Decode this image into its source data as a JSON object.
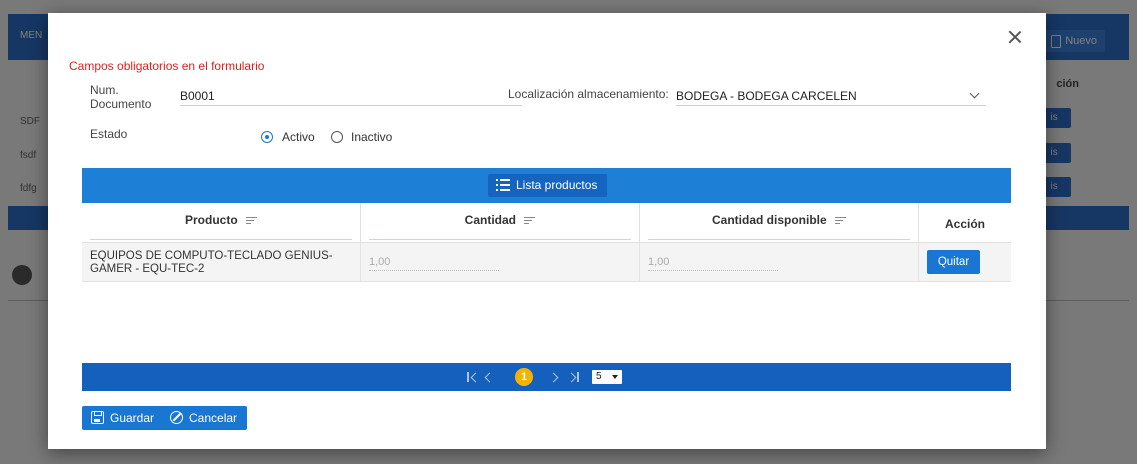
{
  "background": {
    "menu_label": "MEN",
    "nuevo_label": "Nuevo",
    "accion_header": "ción",
    "row_labels": [
      "SDF",
      "fsdf",
      "fdfg"
    ],
    "row_button": "is"
  },
  "modal": {
    "required_note": "Campos obligatorios en el formulario",
    "num_documento_label": "Num. Documento",
    "num_documento_value": "B0001",
    "localizacion_label": "Localización almacenamiento:",
    "localizacion_value": "BODEGA - BODEGA CARCELEN",
    "estado_label": "Estado",
    "estado_options": [
      {
        "label": "Activo",
        "checked": true
      },
      {
        "label": "Inactivo",
        "checked": false
      }
    ]
  },
  "grid": {
    "toolbar_button": "Lista productos",
    "columns": [
      "Producto",
      "Cantidad",
      "Cantidad disponible",
      "Acción"
    ],
    "rows": [
      {
        "producto": "EQUIPOS DE COMPUTO-TECLADO GENIUS-GAMER - EQU-TEC-2",
        "cantidad": "1,00",
        "cantidad_disponible": "1,00",
        "accion": "Quitar"
      }
    ],
    "pager": {
      "current_page": "1",
      "page_size": "5"
    }
  },
  "footer": {
    "save_label": "Guardar",
    "cancel_label": "Cancelar"
  },
  "colors": {
    "primary": "#1976d2",
    "toolbar": "#1e7fd6",
    "pager": "#1560bd",
    "page_highlight": "#f5b301",
    "required_text": "#e02020"
  }
}
